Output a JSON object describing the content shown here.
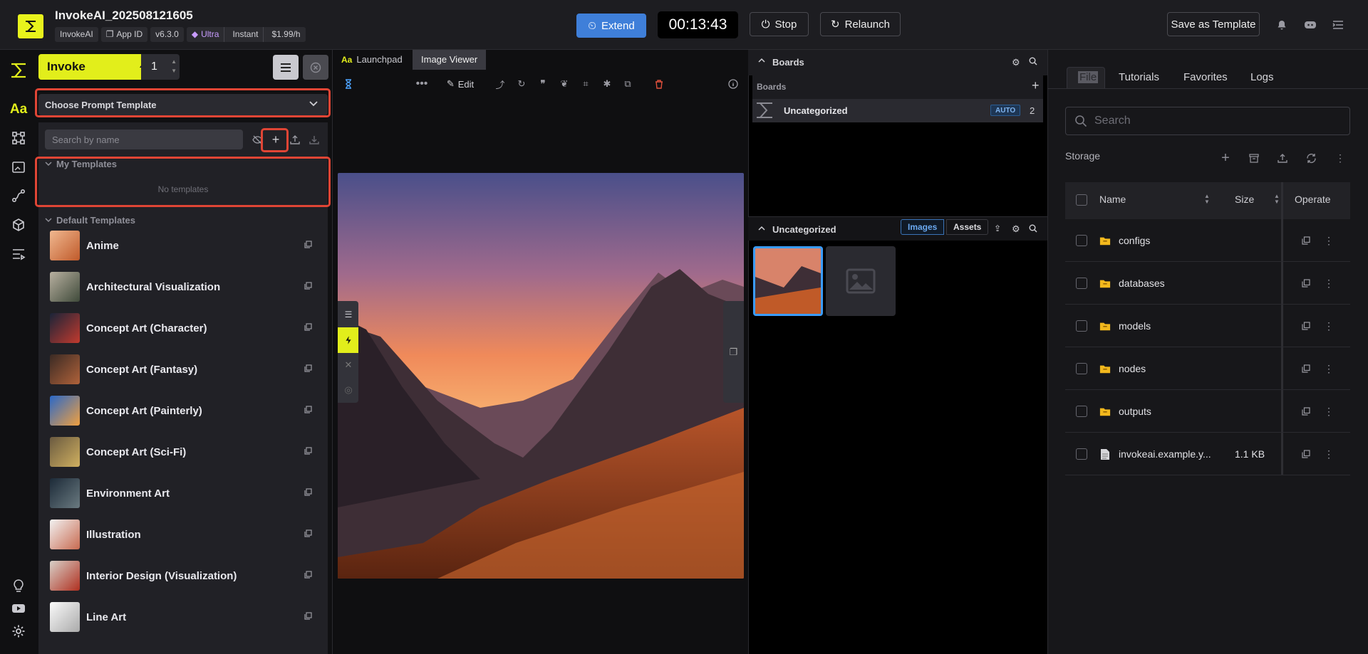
{
  "header": {
    "title": "InvokeAI_202508121605",
    "chips": {
      "app": "InvokeAI",
      "app_id": "App ID",
      "version": "v6.3.0",
      "tier": "Ultra",
      "mode": "Instant",
      "price": "$1.99/h"
    },
    "extend_label": "Extend",
    "timer": "00:13:43",
    "stop_label": "Stop",
    "relaunch_label": "Relaunch",
    "save_template_label": "Save as Template"
  },
  "params": {
    "invoke_label": "Invoke",
    "iterations": "1",
    "prompt_template_select": "Choose Prompt Template",
    "search_placeholder": "Search by name",
    "my_templates_header": "My Templates",
    "no_templates_text": "No templates",
    "default_templates_header": "Default Templates",
    "templates": [
      {
        "name": "Anime",
        "color1": "#f0b890",
        "color2": "#c05a2a"
      },
      {
        "name": "Architectural Visualization",
        "color1": "#b8b0a0",
        "color2": "#3f4a3a"
      },
      {
        "name": "Concept Art (Character)",
        "color1": "#1a2438",
        "color2": "#c23a2e"
      },
      {
        "name": "Concept Art (Fantasy)",
        "color1": "#3a2a24",
        "color2": "#b0623a"
      },
      {
        "name": "Concept Art (Painterly)",
        "color1": "#2a68c8",
        "color2": "#f0a040"
      },
      {
        "name": "Concept Art (Sci-Fi)",
        "color1": "#6a5a40",
        "color2": "#d0b060"
      },
      {
        "name": "Environment Art",
        "color1": "#1c2a38",
        "color2": "#6a7a80"
      },
      {
        "name": "Illustration",
        "color1": "#f2f2f2",
        "color2": "#c86a50"
      },
      {
        "name": "Interior Design (Visualization)",
        "color1": "#d8d0c8",
        "color2": "#b03020"
      },
      {
        "name": "Line Art",
        "color1": "#fafafa",
        "color2": "#aaaaaa"
      }
    ]
  },
  "viewer": {
    "tabs": [
      {
        "label": "Launchpad"
      },
      {
        "label": "Image Viewer"
      }
    ],
    "edit_label": "Edit"
  },
  "boards": {
    "header": "Boards",
    "subheader": "Boards",
    "board_name": "Uncategorized",
    "auto_badge": "AUTO",
    "board_count": "2",
    "gallery_header": "Uncategorized",
    "images_tab": "Images",
    "assets_tab": "Assets"
  },
  "files": {
    "tabs": [
      {
        "label": "File"
      },
      {
        "label": "Tutorials"
      },
      {
        "label": "Favorites"
      },
      {
        "label": "Logs"
      }
    ],
    "search_placeholder": "Search",
    "storage_label": "Storage",
    "columns": {
      "name": "Name",
      "size": "Size",
      "operate": "Operate"
    },
    "rows": [
      {
        "name": "configs",
        "size": "",
        "type": "folder"
      },
      {
        "name": "databases",
        "size": "",
        "type": "folder"
      },
      {
        "name": "models",
        "size": "",
        "type": "folder"
      },
      {
        "name": "nodes",
        "size": "",
        "type": "folder"
      },
      {
        "name": "outputs",
        "size": "",
        "type": "folder"
      },
      {
        "name": "invokeai.example.y...",
        "size": "1.1 KB",
        "type": "file"
      }
    ]
  }
}
